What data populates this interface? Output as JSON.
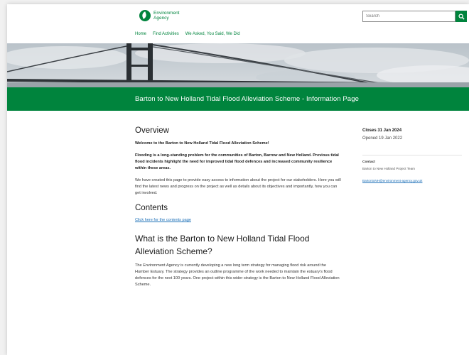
{
  "colors": {
    "brand_green": "#00843d",
    "link_blue": "#1d70b8"
  },
  "header": {
    "logo_icon": "environment-agency-leaf-icon",
    "logo_line1": "Environment",
    "logo_line2": "Agency",
    "search_placeholder": "Search",
    "search_icon": "search-icon"
  },
  "nav": {
    "home": "Home",
    "find_activities": "Find Activities",
    "we_asked": "We Asked, You Said, We Did"
  },
  "hero": {
    "image": "Humber Bridge photograph with cloudy sky"
  },
  "banner": {
    "title": "Barton to New Holland Tidal Flood Alleviation Scheme - Information Page"
  },
  "main": {
    "overview_heading": "Overview",
    "welcome": "Welcome to the Barton to New Holland Tidal Flood Alleviation Scheme!",
    "flooding": "Flooding is a long-standing problem for the communities of Barton, Barrow and New Holland. Previous tidal flood incidents highlight the need for improved tidal flood defences and increased community resilience within these areas.",
    "created": "We have created this page to provide easy access to information about the project for our stakeholders. Here you will find the latest news and progress on the project as well as details about its objectives and importantly, how you can get involved.",
    "contents_heading": "Contents",
    "contents_link": "Click here for the contents page",
    "what_heading": "What is the Barton to New Holland Tidal Flood Alleviation Scheme?",
    "what_body": "The Environment Agency is currently developing a new long term strategy for managing flood risk around the Humber Estuary. The strategy provides an outline programme of the work needed to maintain the estuary's flood defences for the next 100 years. One project within this wider strategy is the Barton to New Holland Flood Alleviation Scheme."
  },
  "sidebar": {
    "closes": "Closes 31 Jan 2024",
    "opened": "Opened 19 Jan 2022",
    "contact_label": "Contact",
    "contact_name": "Barton to New Holland Project Team",
    "contact_email": "BartontoNH@environment-agency.gov.uk"
  }
}
